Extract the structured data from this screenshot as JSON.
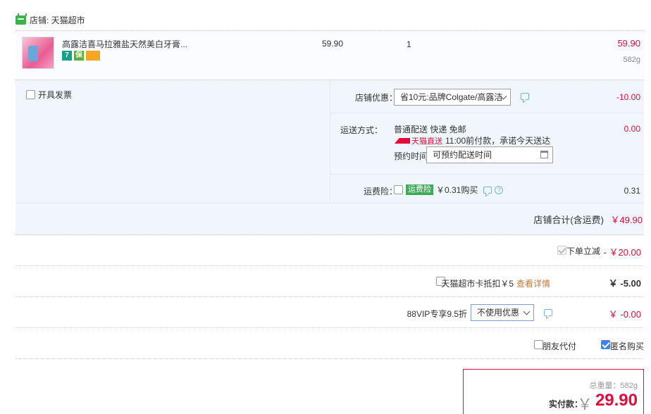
{
  "shop": {
    "label": "店铺: 天猫超市"
  },
  "item": {
    "title": "高露洁喜马拉雅盐天然美白牙膏...",
    "badges": [
      "7",
      "保",
      "卡"
    ],
    "unit_price": "59.90",
    "quantity": "1",
    "subtotal": "59.90",
    "weight": "582g"
  },
  "invoice": {
    "label": "开具发票",
    "checked": false
  },
  "coupon": {
    "label": "店铺优惠：",
    "selected": "省10元:品牌Colgate/高露洁",
    "value": "-10.00"
  },
  "shipping": {
    "label": "运送方式：",
    "method": "普通配送 快递 免邮",
    "tmall_tag": "天猫直送",
    "delivery_note": "11:00前付款，承诺今天送达",
    "appointment_label": "预约时间",
    "appointment_placeholder": "可预约配送时间",
    "value": "0.00"
  },
  "insurance": {
    "label": "运费险：",
    "tag": "运费险",
    "price": "￥0.31购买",
    "value": "0.31"
  },
  "shop_total": {
    "label": "店铺合计(含运费)",
    "value": "￥49.90"
  },
  "summary": {
    "instant_discount": {
      "label": "下单立减",
      "value": "- ￥20.00",
      "checked": true
    },
    "supermarket_card": {
      "label": "天猫超市卡抵扣￥5",
      "link": "查看详情",
      "value": "￥ -5.00"
    },
    "vip": {
      "label": "88VIP专享9.5折",
      "selected": "不使用优惠",
      "value": "￥ -0.00"
    },
    "friend_pay": {
      "label": "朋友代付",
      "checked": false
    },
    "anonymous": {
      "label": "匿名购买",
      "checked": true
    }
  },
  "payment": {
    "weight_label": "总重量：582g",
    "label": "实付款：",
    "currency": "￥",
    "amount": "29.90"
  },
  "colors": {
    "accent_red": "#e10c39",
    "panel_bg": "#f1f6fd",
    "link_orange": "#c0793a"
  }
}
